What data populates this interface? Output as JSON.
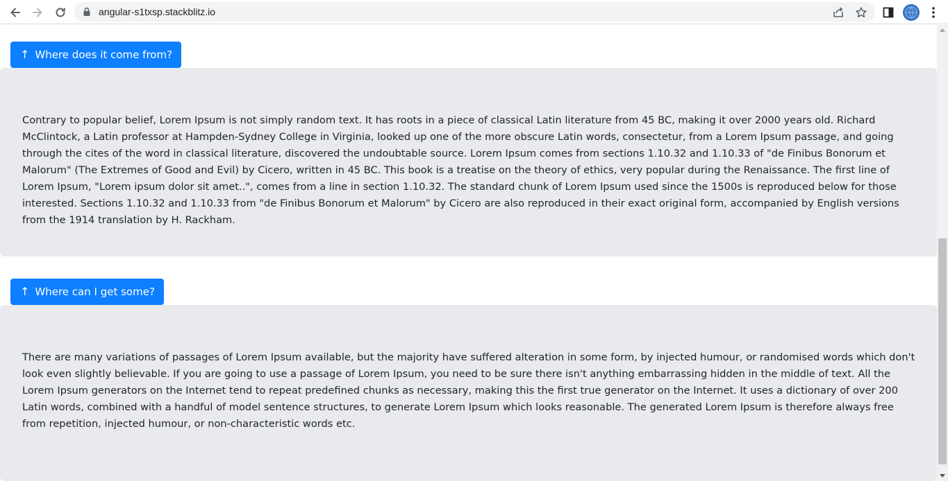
{
  "browser": {
    "url": "angular-s1txsp.stackblitz.io",
    "icons": {
      "back": "back-arrow-icon",
      "forward": "forward-arrow-icon",
      "reload": "reload-icon",
      "lock": "lock-icon",
      "share": "share-icon",
      "bookmark": "star-icon",
      "side_panel": "side-panel-icon",
      "profile": "avatar",
      "menu": "kebab-menu-icon"
    }
  },
  "sections": [
    {
      "button_label": "Where does it come from?",
      "arrow": "↑",
      "text": "Contrary to popular belief, Lorem Ipsum is not simply random text. It has roots in a piece of classical Latin literature from 45 BC, making it over 2000 years old. Richard McClintock, a Latin professor at Hampden-Sydney College in Virginia, looked up one of the more obscure Latin words, consectetur, from a Lorem Ipsum passage, and going through the cites of the word in classical literature, discovered the undoubtable source. Lorem Ipsum comes from sections 1.10.32 and 1.10.33 of \"de Finibus Bonorum et Malorum\" (The Extremes of Good and Evil) by Cicero, written in 45 BC. This book is a treatise on the theory of ethics, very popular during the Renaissance. The first line of Lorem Ipsum, \"Lorem ipsum dolor sit amet..\", comes from a line in section 1.10.32. The standard chunk of Lorem Ipsum used since the 1500s is reproduced below for those interested. Sections 1.10.32 and 1.10.33 from \"de Finibus Bonorum et Malorum\" by Cicero are also reproduced in their exact original form, accompanied by English versions from the 1914 translation by H. Rackham."
    },
    {
      "button_label": "Where can I get some?",
      "arrow": "↑",
      "text": "There are many variations of passages of Lorem Ipsum available, but the majority have suffered alteration in some form, by injected humour, or randomised words which don't look even slightly believable. If you are going to use a passage of Lorem Ipsum, you need to be sure there isn't anything embarrassing hidden in the middle of text. All the Lorem Ipsum generators on the Internet tend to repeat predefined chunks as necessary, making this the first true generator on the Internet. It uses a dictionary of over 200 Latin words, combined with a handful of model sentence structures, to generate Lorem Ipsum which looks reasonable. The generated Lorem Ipsum is therefore always free from repetition, injected humour, or non-characteristic words etc."
    }
  ],
  "colors": {
    "button_bg": "#0d7fff",
    "panel_bg": "#e9eaee",
    "text": "#212529"
  }
}
